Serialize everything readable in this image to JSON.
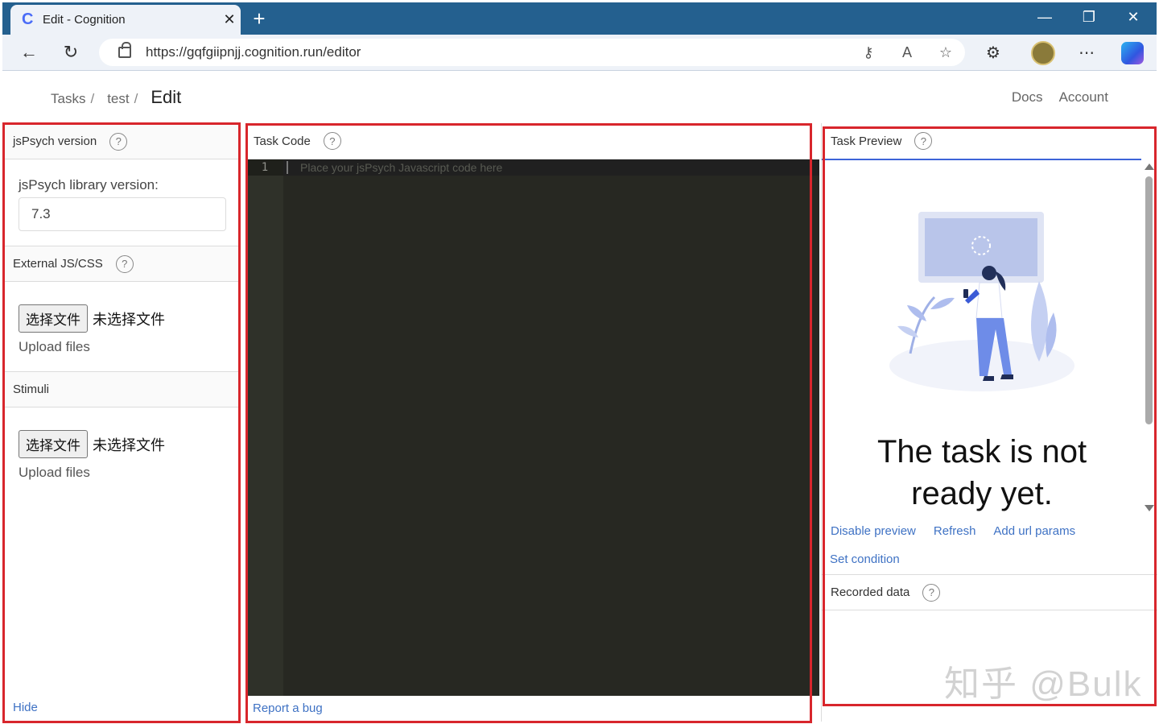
{
  "browser": {
    "tab_title": "Edit - Cognition",
    "tab_logo": "C",
    "new_tab": "+",
    "url_host": "https://gqfgiipnjj.cognition.run/editor"
  },
  "header": {
    "crumbs": [
      {
        "label": "Tasks",
        "sep": "/"
      },
      {
        "label": "test",
        "sep": "/"
      }
    ],
    "current": "Edit",
    "links": [
      "Docs",
      "Account"
    ]
  },
  "left_panel": {
    "jspsych_title": "jsPsych version",
    "lib_label": "jsPsych library version:",
    "lib_value": "7.3",
    "external_title": "External JS/CSS",
    "file_button": "选择文件",
    "file_none": "未选择文件",
    "upload_label": "Upload files",
    "stimuli_title": "Stimuli",
    "stimuli_file_button": "选择文件",
    "stimuli_file_none": "未选择文件",
    "stimuli_upload_label": "Upload files",
    "hide_link": "Hide",
    "help_symbol": "?"
  },
  "code_panel": {
    "title": "Task Code",
    "line_number": "1",
    "placeholder": "Place your jsPsych Javascript code here",
    "report_link": "Report a bug"
  },
  "preview_panel": {
    "title": "Task Preview",
    "not_ready_line1": "The task is not",
    "not_ready_line2": "ready yet.",
    "links": [
      "Disable preview",
      "Refresh",
      "Add url params"
    ],
    "set_condition": "Set condition",
    "recorded_title": "Recorded data",
    "watermark": "知乎 @Bulk"
  }
}
